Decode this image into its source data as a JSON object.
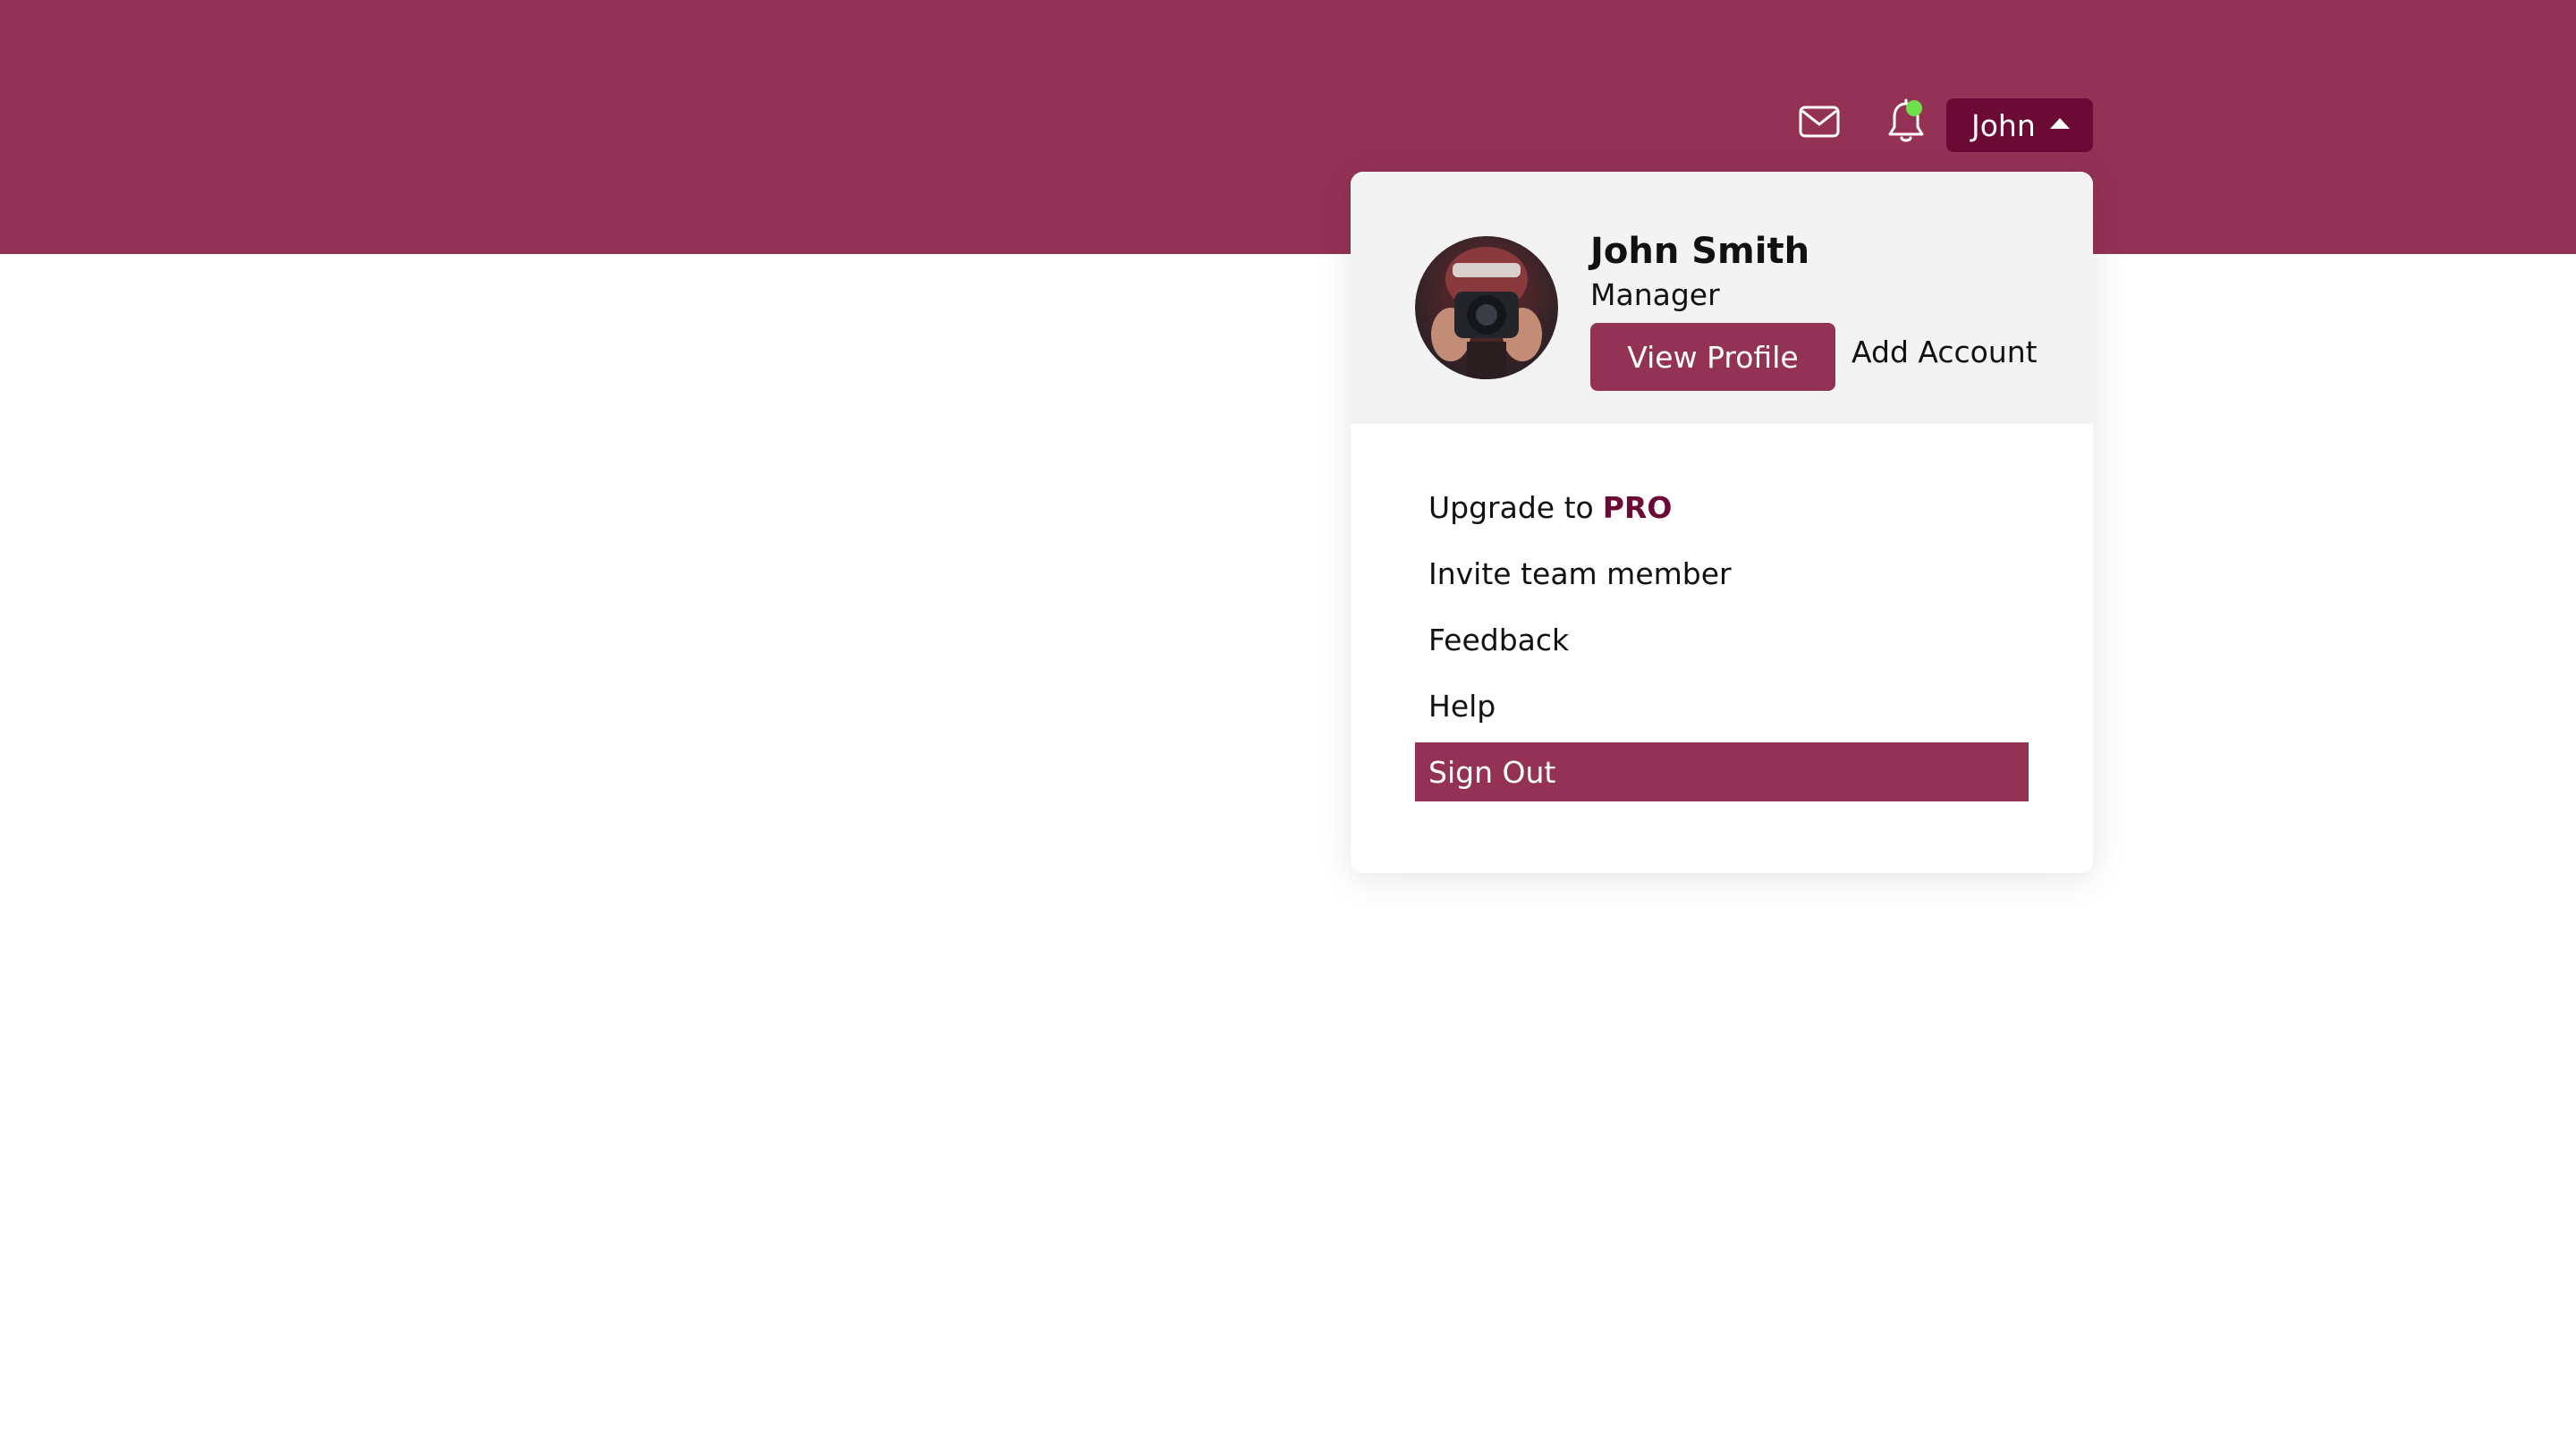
{
  "colors": {
    "brand": "#943256",
    "brand_dark": "#6b0a35",
    "notification_dot": "#6ee04c",
    "header_panel": "#f3f3f3"
  },
  "topbar": {
    "mail_icon": "mail-icon",
    "bell_icon": "bell-icon",
    "user_button_label": "John"
  },
  "profile": {
    "name": "John Smith",
    "role": "Manager",
    "view_profile_label": "View Profile",
    "add_account_label": "Add Account"
  },
  "menu": {
    "upgrade_prefix": "Upgrade to",
    "upgrade_highlight": "PRO",
    "items": [
      {
        "label": "Invite team member"
      },
      {
        "label": "Feedback"
      },
      {
        "label": "Help"
      },
      {
        "label": "Sign Out"
      }
    ]
  }
}
